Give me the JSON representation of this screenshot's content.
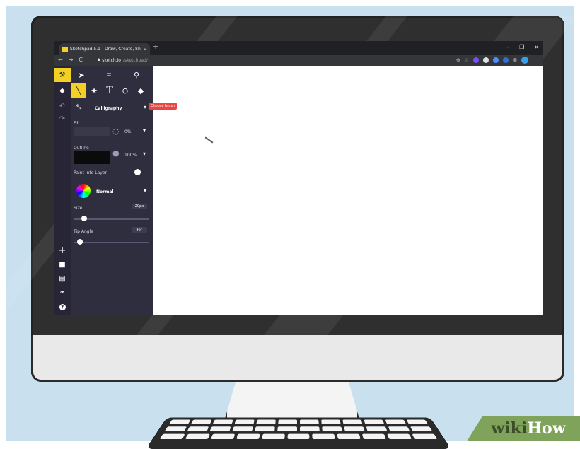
{
  "colors": {
    "accent": "#f2d024",
    "tooltip": "#e84545",
    "sidebar": "#2f2e3f",
    "rail": "#282636",
    "wikihow_green": "#7fa35a"
  },
  "browser": {
    "tab_title": "Sketchpad 5.1 - Draw, Create, Sh",
    "tab_close": "×",
    "new_tab": "+",
    "url_host": "sketch.io",
    "url_path": "/sketchpad/",
    "nav_back": "←",
    "nav_forward": "→",
    "nav_reload": "C",
    "window_minimize": "–",
    "window_maximize": "❐",
    "window_close": "×"
  },
  "rail": {
    "items": [
      {
        "icon": "tools-icon",
        "glyph": "⚒"
      },
      {
        "icon": "layers-icon",
        "glyph": "◆"
      },
      {
        "icon": "undo-icon",
        "glyph": "↶"
      },
      {
        "icon": "redo-icon",
        "glyph": "↷"
      }
    ],
    "bottom_items": [
      {
        "icon": "plus-icon",
        "glyph": "+"
      },
      {
        "icon": "folder-icon",
        "glyph": "■"
      },
      {
        "icon": "save-icon",
        "glyph": "▤"
      },
      {
        "icon": "share-icon",
        "glyph": "⚭"
      },
      {
        "icon": "help-icon",
        "glyph": "?"
      }
    ]
  },
  "tools": [
    {
      "icon": "select-arrow-icon",
      "glyph": "➤"
    },
    {
      "icon": "crop-icon",
      "glyph": "⌗"
    },
    {
      "icon": "zoom-icon",
      "glyph": "⚲"
    },
    {
      "icon": "brush-icon",
      "glyph": "╲",
      "active": true
    },
    {
      "icon": "star-icon",
      "glyph": "★"
    },
    {
      "icon": "text-icon",
      "glyph": "T"
    },
    {
      "icon": "eraser-icon",
      "glyph": "⊖"
    },
    {
      "icon": "fill-icon",
      "glyph": "◆"
    }
  ],
  "brush": {
    "name": "Calligraphy",
    "tooltip": "Choose brush",
    "fill_label": "Fill",
    "fill_opacity": "0%",
    "outline_label": "Outline",
    "outline_opacity": "100%",
    "paint_into_layer_label": "Paint Into Layer",
    "blend_mode": "Normal",
    "size_label": "Size",
    "size_value": "20px",
    "size_fraction": 0.1,
    "tip_angle_label": "Tip Angle",
    "tip_angle_value": "45°",
    "tip_angle_fraction": 0.05
  },
  "watermark": {
    "wiki": "wiki",
    "how": "How"
  }
}
